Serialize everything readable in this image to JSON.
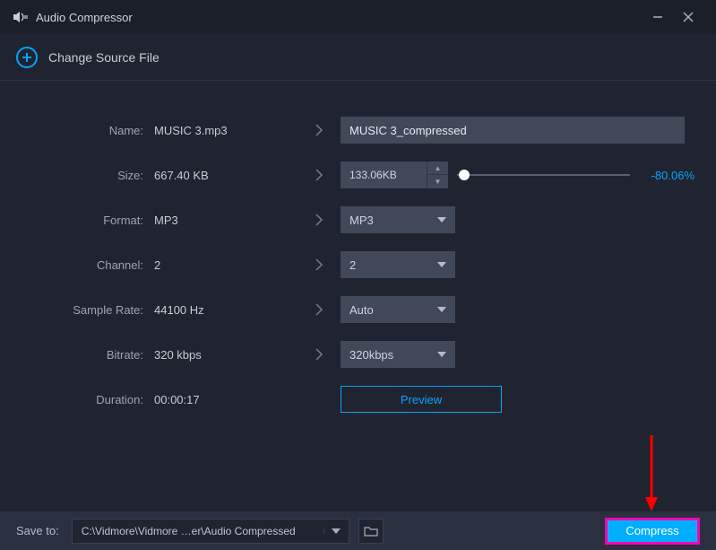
{
  "title": "Audio Compressor",
  "change_source": "Change Source File",
  "rows": {
    "name": {
      "label": "Name:",
      "value": "MUSIC 3.mp3",
      "newname": "MUSIC 3_compressed"
    },
    "size": {
      "label": "Size:",
      "value": "667.40 KB",
      "newsize": "133.06KB",
      "pct": "-80.06%"
    },
    "format": {
      "label": "Format:",
      "value": "MP3",
      "select": "MP3"
    },
    "channel": {
      "label": "Channel:",
      "value": "2",
      "select": "2"
    },
    "sample": {
      "label": "Sample Rate:",
      "value": "44100 Hz",
      "select": "Auto"
    },
    "bitrate": {
      "label": "Bitrate:",
      "value": "320 kbps",
      "select": "320kbps"
    },
    "duration": {
      "label": "Duration:",
      "value": "00:00:17"
    }
  },
  "preview": "Preview",
  "footer": {
    "saveto": "Save to:",
    "path": "C:\\Vidmore\\Vidmore …er\\Audio Compressed",
    "compress": "Compress"
  }
}
